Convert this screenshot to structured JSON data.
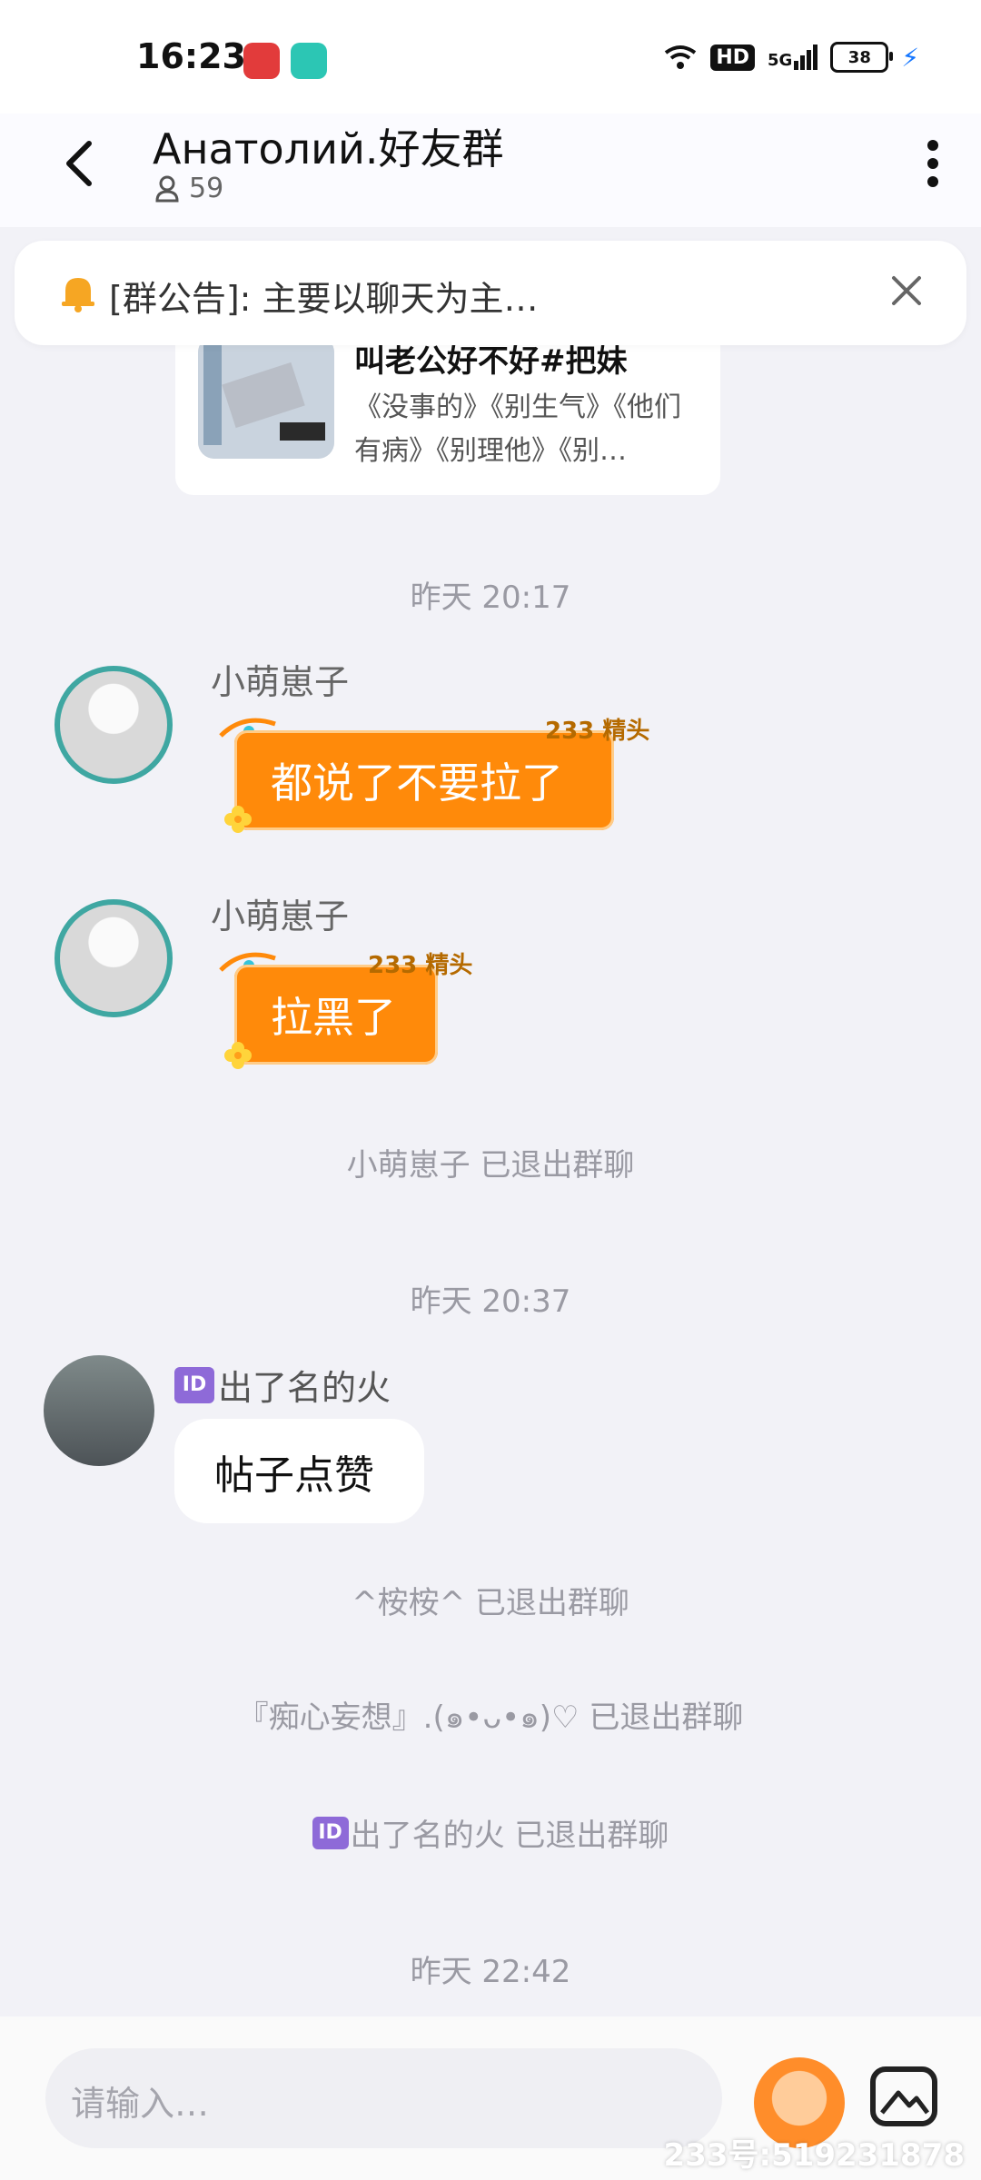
{
  "status_bar": {
    "time": "16:23",
    "network": "5G",
    "hd": "HD",
    "battery": "38"
  },
  "header": {
    "title": "Анатолий.好友群",
    "member_count": "59"
  },
  "announcement": {
    "text": "[群公告]: 主要以聊天为主…"
  },
  "card": {
    "title": "叫老公好不好#把妹",
    "desc": "《没事的》《别生气》《他们有病》《别理他》《别…"
  },
  "chat": {
    "ts1": "昨天 20:17",
    "msg1_name": "小萌崽子",
    "msg1_text": "都说了不要拉了",
    "msg2_name": "小萌崽子",
    "msg2_text": "拉黑了",
    "sys1": "小萌崽子 已退出群聊",
    "ts2": "昨天 20:37",
    "msg3_badge": "ID",
    "msg3_name": "出了名的火",
    "msg3_text": "帖子点赞",
    "sys2": "^桉桉^ 已退出群聊",
    "sys3": "『痴心妄想』.(๑•ᴗ•๑)♡ 已退出群聊",
    "sys4_badge": "ID",
    "sys4": "出了名的火 已退出群聊",
    "ts3": "昨天 22:42"
  },
  "input": {
    "placeholder": "请输入…"
  },
  "watermark": "233号:519231878",
  "decor_text": "233 精头"
}
